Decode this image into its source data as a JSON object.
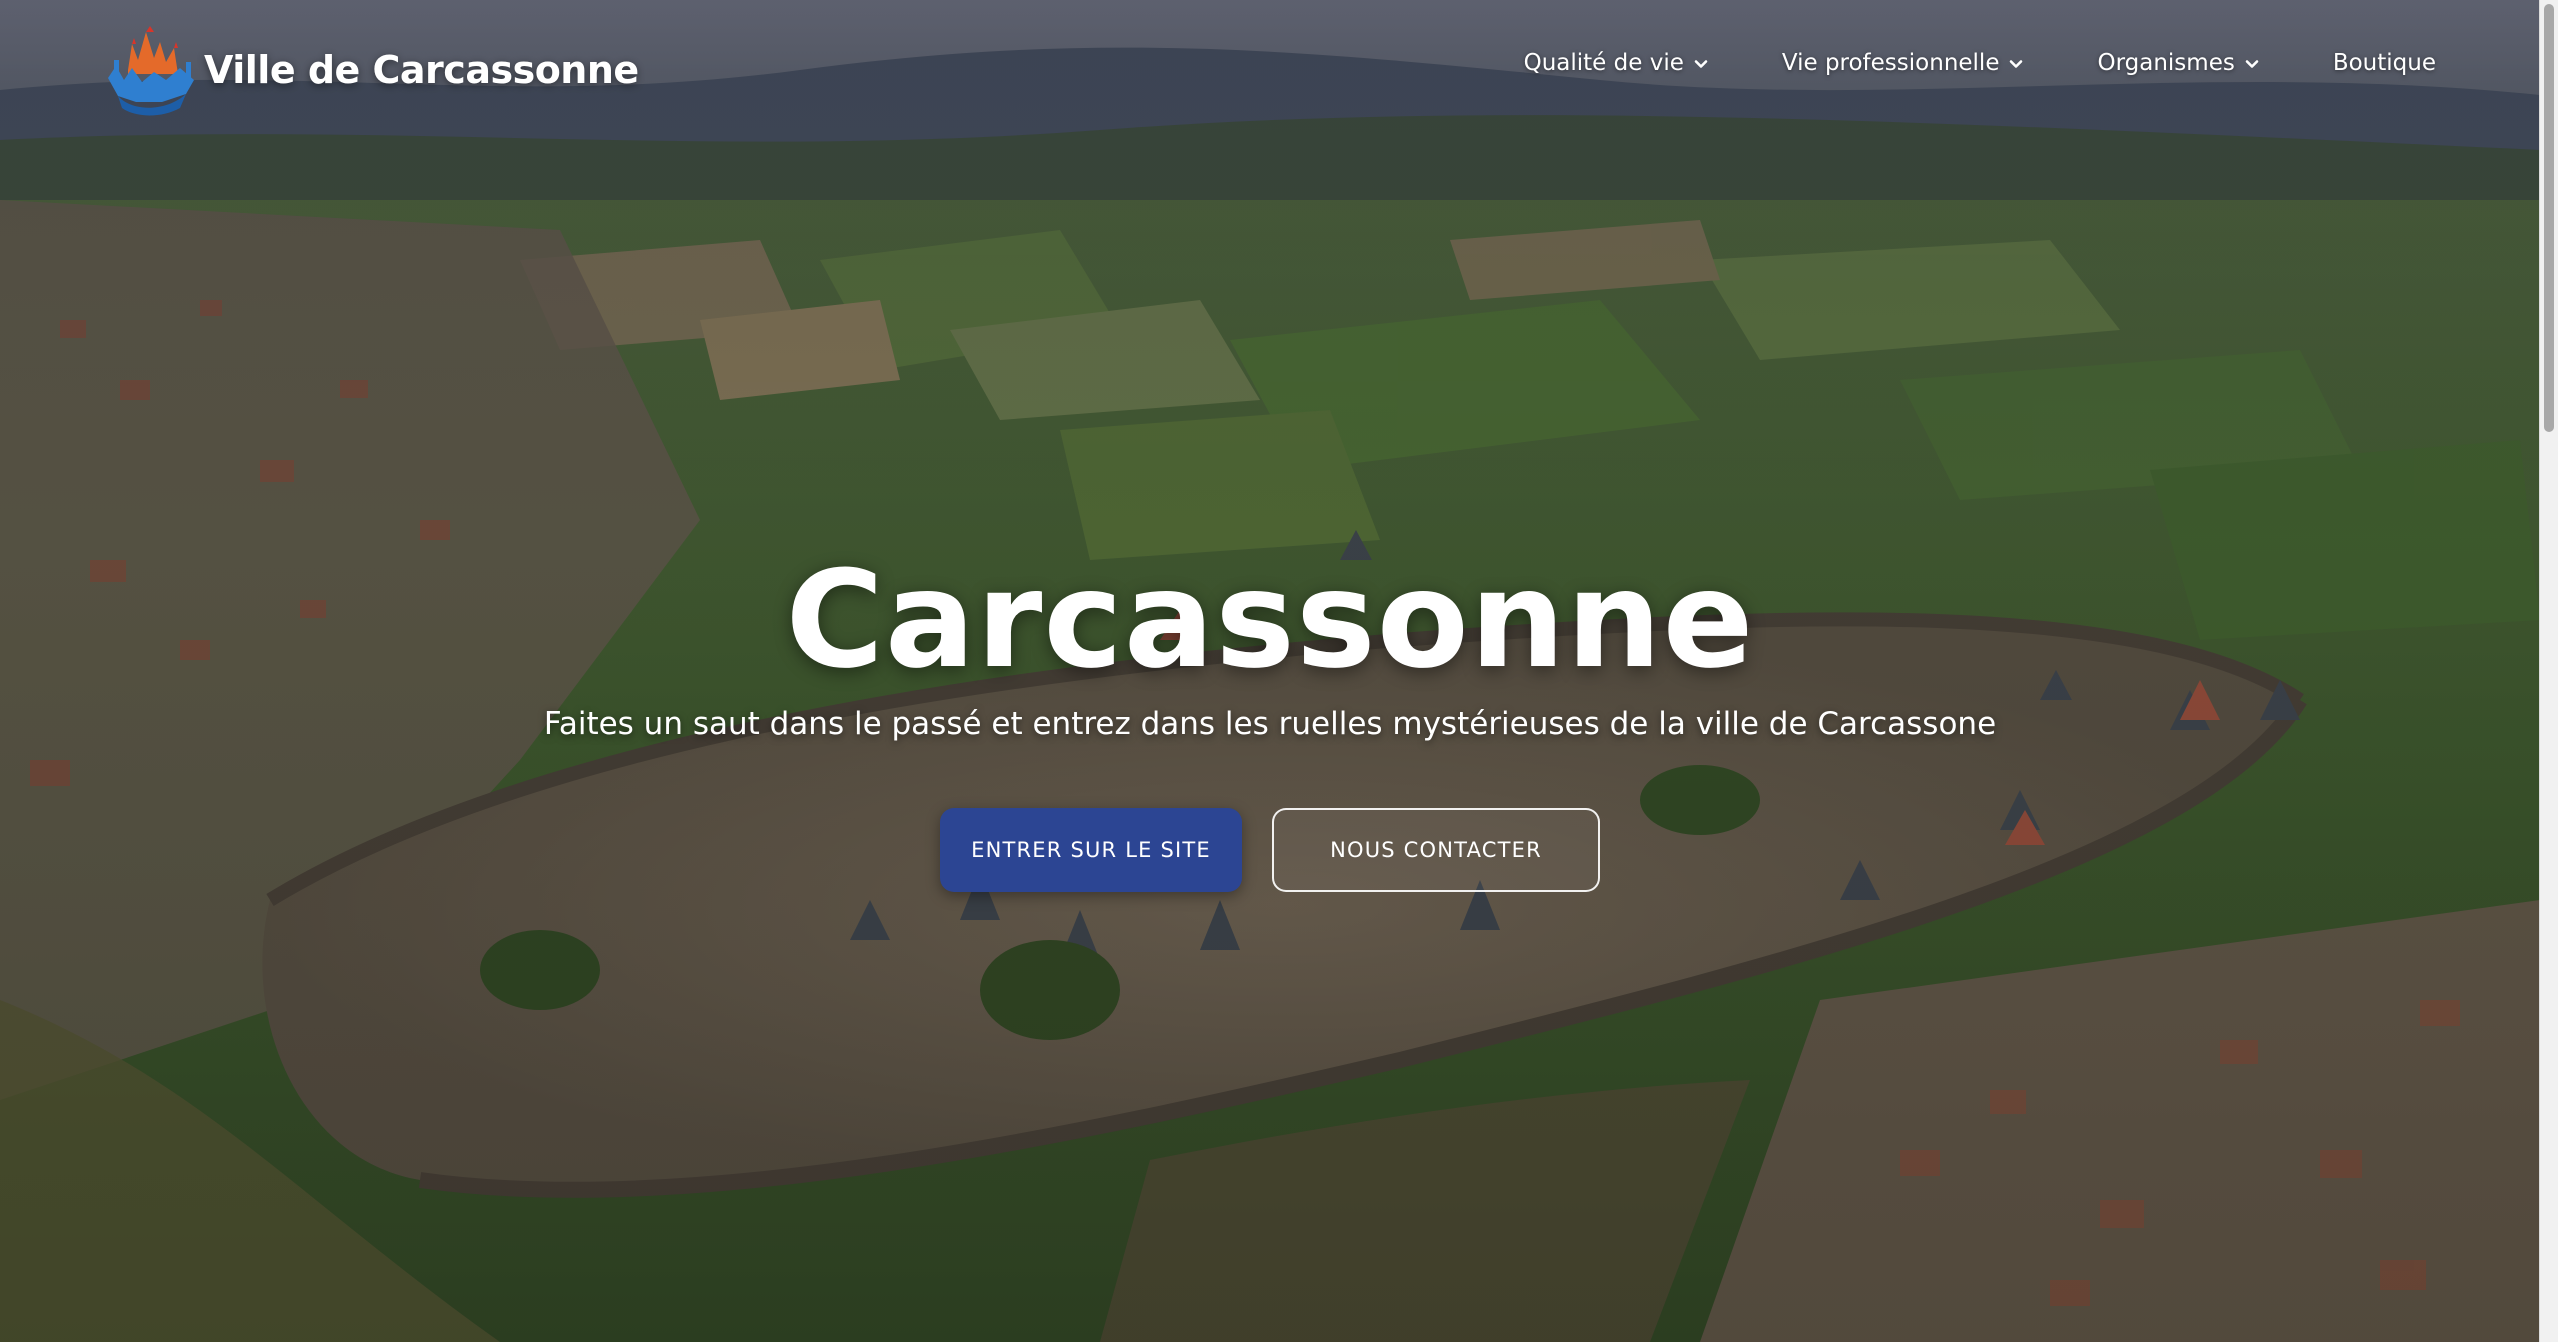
{
  "header": {
    "logo_text": "Ville de Carcassonne",
    "nav": [
      {
        "label": "Qualité de vie",
        "has_dropdown": true
      },
      {
        "label": "Vie professionnelle",
        "has_dropdown": true
      },
      {
        "label": "Organismes",
        "has_dropdown": true
      },
      {
        "label": "Boutique",
        "has_dropdown": false
      }
    ]
  },
  "hero": {
    "title": "Carcassonne",
    "subtitle": "Faites un saut dans le passé et entrez dans les ruelles mystérieuses de la ville de Carcassone",
    "primary_button": "ENTRER SUR LE SITE",
    "secondary_button": "NOUS CONTACTER"
  },
  "colors": {
    "primary_button": "#2c4593",
    "logo_blue": "#2f7fd0",
    "logo_orange": "#f07a2a",
    "logo_red": "#d8352a"
  },
  "icons": {
    "logo": "carcassonne-castle-logo-icon",
    "dropdown": "chevron-down-icon"
  }
}
